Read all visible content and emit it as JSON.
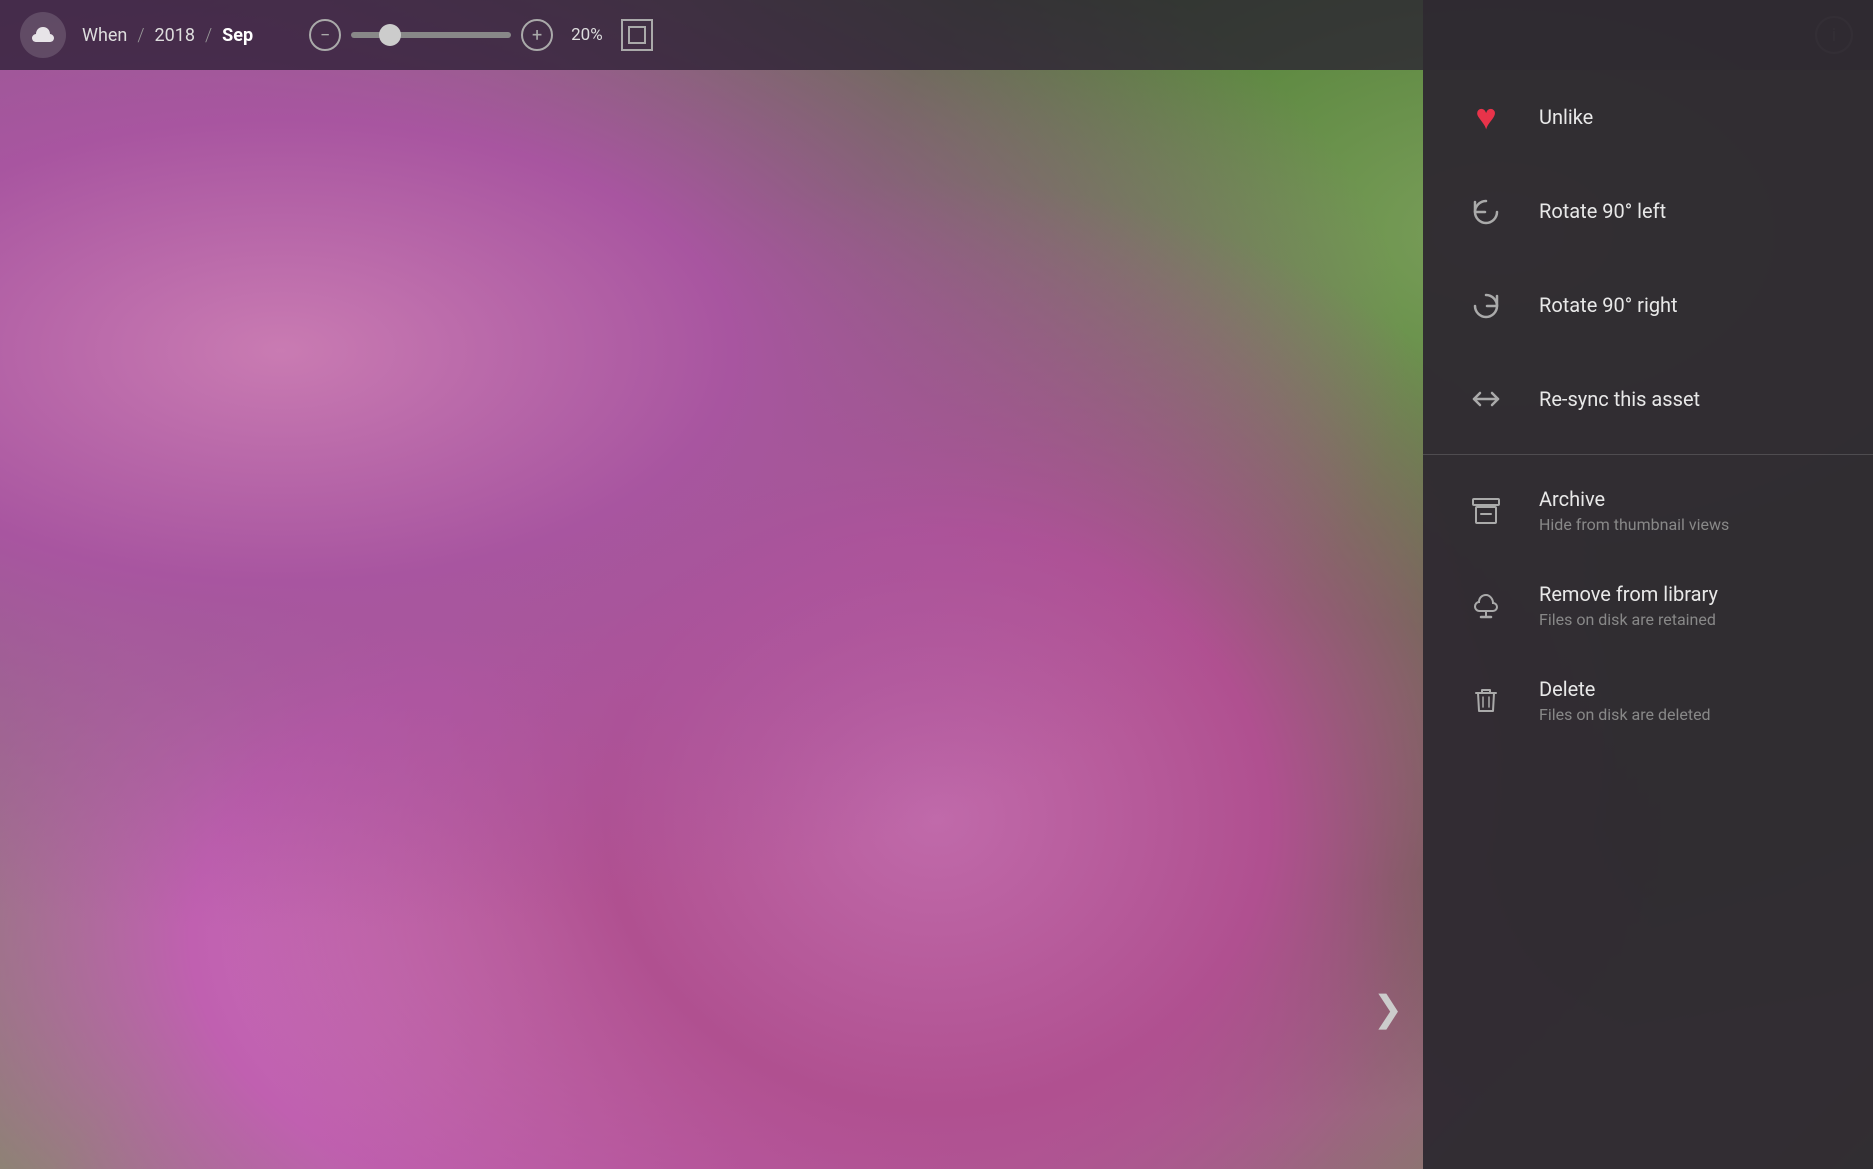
{
  "topbar": {
    "app_icon": "☁",
    "breadcrumb": {
      "when_label": "When",
      "sep1": "/",
      "year_label": "2018",
      "sep2": "/",
      "month_label": "Sep"
    },
    "zoom": {
      "decrease_label": "−",
      "increase_label": "+",
      "percent_label": "20%"
    },
    "info_label": "i"
  },
  "context_menu": {
    "items": [
      {
        "id": "unlike",
        "label": "Unlike",
        "sublabel": "",
        "icon_type": "heart"
      },
      {
        "id": "rotate_left",
        "label": "Rotate 90° left",
        "sublabel": "",
        "icon_type": "rotate_left"
      },
      {
        "id": "rotate_right",
        "label": "Rotate 90° right",
        "sublabel": "",
        "icon_type": "rotate_right"
      },
      {
        "id": "resync",
        "label": "Re-sync this asset",
        "sublabel": "",
        "icon_type": "resync"
      },
      {
        "id": "archive",
        "label": "Archive",
        "sublabel": "Hide from thumbnail views",
        "icon_type": "archive"
      },
      {
        "id": "remove",
        "label": "Remove from library",
        "sublabel": "Files on disk are retained",
        "icon_type": "remove_cloud"
      },
      {
        "id": "delete",
        "label": "Delete",
        "sublabel": "Files on disk are deleted",
        "icon_type": "trash"
      }
    ],
    "divider_after": 3
  },
  "nav": {
    "next_label": "❯"
  }
}
